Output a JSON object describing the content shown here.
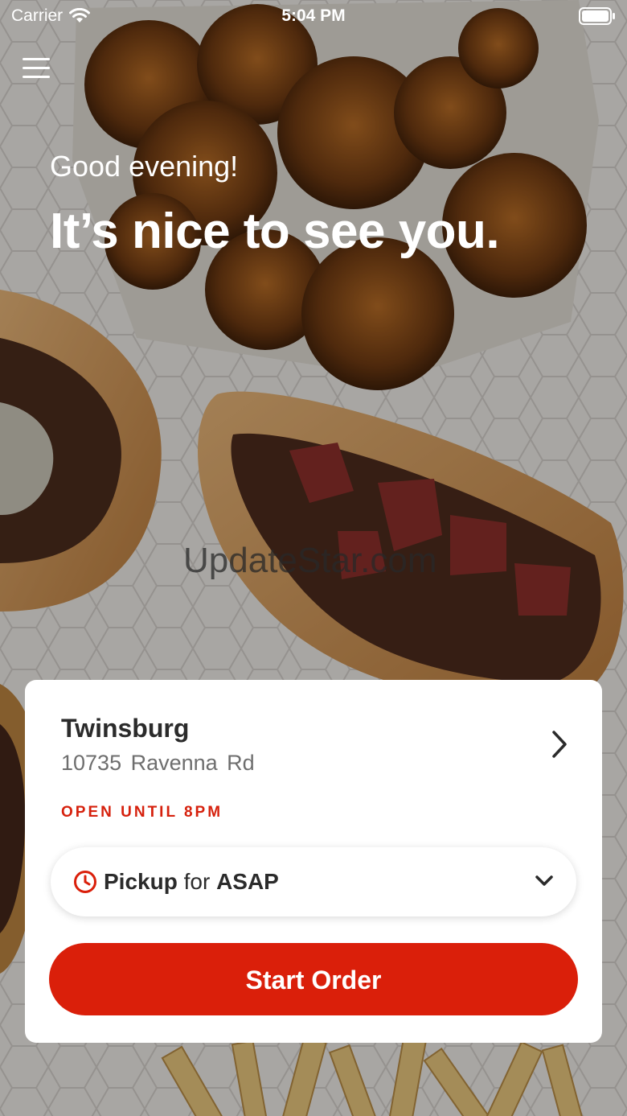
{
  "status_bar": {
    "carrier": "Carrier",
    "time": "5:04 PM",
    "icons": [
      "wifi-icon",
      "battery-icon"
    ]
  },
  "header": {
    "menu_icon": "hamburger-menu-icon",
    "greeting": "Good evening!",
    "headline": "It’s nice to see you."
  },
  "watermark": "UpdateStar.com",
  "store_card": {
    "name": "Twinsburg",
    "address": "10735  Ravenna Rd",
    "open_status": "OPEN UNTIL 8PM",
    "chevron_icon": "chevron-right-icon",
    "order_type": {
      "icon": "clock-icon",
      "mode": "Pickup",
      "connector": "for",
      "time": "ASAP",
      "dropdown_icon": "chevron-down-icon"
    },
    "start_button_label": "Start Order"
  },
  "colors": {
    "accent": "#da1f0a",
    "card_bg": "#ffffff",
    "text_dark": "#2b2b2b",
    "text_muted": "#6e6e6e"
  }
}
